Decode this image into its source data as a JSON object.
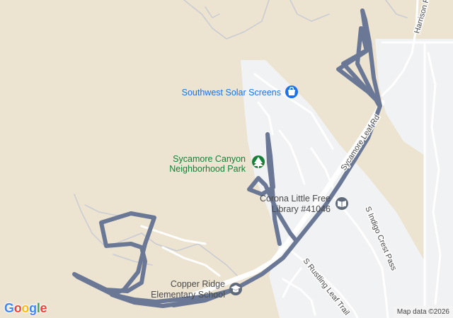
{
  "map": {
    "colors": {
      "land": "#ece3d1",
      "residential": "#f1f2f4",
      "minor_road": "#ffffff",
      "road_casing": "#c9ccd3",
      "route": "#6a7896",
      "poi_blue": "#1a73e8",
      "poi_green": "#188038"
    },
    "pois": [
      {
        "id": "solar",
        "name_lines": [
          "Southwest Solar Screens"
        ],
        "icon": "shopping-bag-icon",
        "color": "#1a73e8"
      },
      {
        "id": "park",
        "name_lines": [
          "Sycamore Canyon",
          "Neighborhood Park"
        ],
        "icon": "tree-icon",
        "color": "#188038"
      },
      {
        "id": "library",
        "name_lines": [
          "Corona Little Free",
          "Library #41046"
        ],
        "icon": "book-icon",
        "color": "#4a4a4a"
      },
      {
        "id": "school",
        "name_lines": [
          "Copper Ridge",
          "Elementary School"
        ],
        "icon": "graduation-cap-icon",
        "color": "#4a4a4a"
      }
    ],
    "streets": [
      {
        "id": "sycamore-leaf",
        "name": "Sycamore Leaf Rd"
      },
      {
        "id": "harrison",
        "name": "Harrison R"
      },
      {
        "id": "indigo-crest",
        "name": "S Indigo Crest Pass"
      },
      {
        "id": "rustling-leaf",
        "name": "S Rustling Leaf Trail"
      }
    ],
    "branding": {
      "logo_text": "Google"
    },
    "attribution": "Map data ©2026"
  }
}
